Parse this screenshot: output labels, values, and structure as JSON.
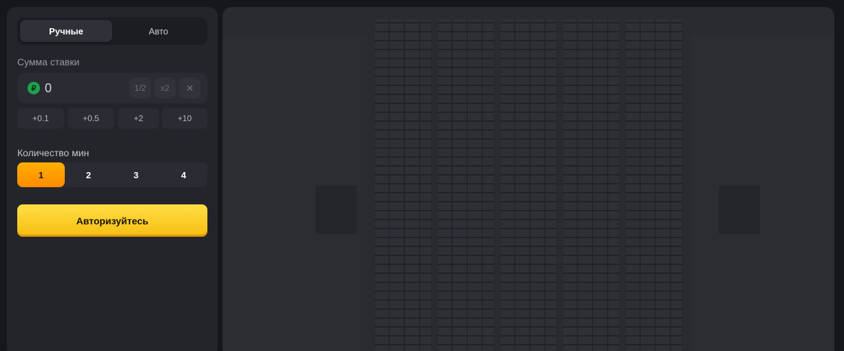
{
  "tabs": [
    {
      "label": "Ручные",
      "active": true
    },
    {
      "label": "Авто",
      "active": false
    }
  ],
  "bet": {
    "label": "Сумма ставки",
    "currency_icon": "ruble-coin-icon",
    "currency_symbol": "₽",
    "value": "0",
    "half_label": "1/2",
    "double_label": "x2",
    "clear_icon": "close-icon",
    "clear_symbol": "✕",
    "quick_add": [
      "+0.1",
      "+0.5",
      "+2",
      "+10"
    ]
  },
  "mines": {
    "label": "Количество мин",
    "options": [
      "1",
      "2",
      "3",
      "4"
    ],
    "selected": "1"
  },
  "auth_button": "Авторизуйтесь",
  "colors": {
    "accent_orange": "#ff9a00",
    "button_yellow": "#fdd12b",
    "coin_green": "#1fa24a"
  }
}
